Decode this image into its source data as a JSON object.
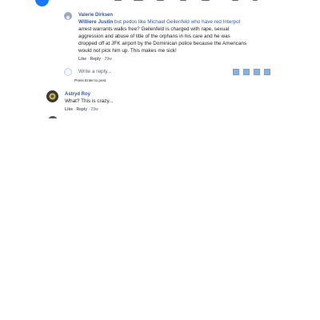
{
  "comments": [
    {
      "author": "Valerie Dirksen",
      "mention": "Williere Justin",
      "text_first_line_rest": " but pedos like Michael Geilenfeld who have red Interpol",
      "text_lines": [
        "arrest warrants walks free? Geilenfeld is charged with rape, sexual",
        "aggression and abuse of title of the orphans in his care and he was",
        "dropped off at JFK airport by the Dominican police because the Americans",
        "would not pick him up. This makes me sick!"
      ],
      "like": "Like",
      "reply": "Reply",
      "time": "29w"
    },
    {
      "author": "Astryd Roy",
      "text_lines": [
        "What? This is crazy..."
      ],
      "like": "Like",
      "reply": "Reply",
      "time": "29w"
    }
  ],
  "reply_box": {
    "placeholder": "Write a reply...",
    "hint": "Press Enter to post."
  },
  "colors": {
    "link": "#385898",
    "brand": "#1877f2"
  },
  "icons": [
    "facebook-logo-icon",
    "avatar-icon",
    "emoji-icon",
    "camera-icon",
    "gif-icon",
    "sticker-icon"
  ]
}
